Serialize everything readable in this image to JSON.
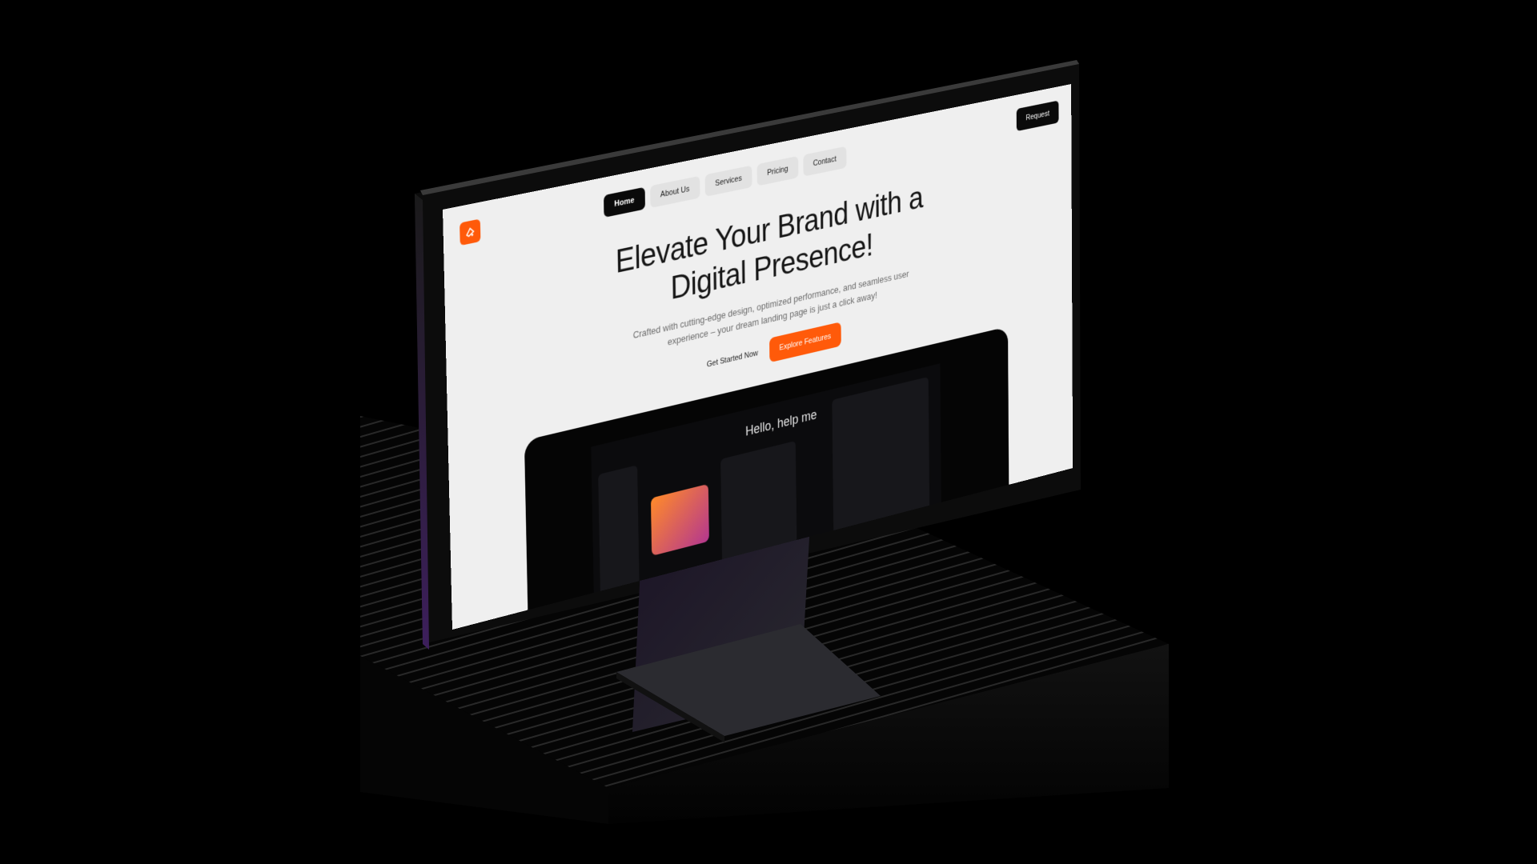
{
  "website": {
    "nav": {
      "items": [
        "Home",
        "About Us",
        "Services",
        "Pricing",
        "Contact"
      ],
      "active": "Home"
    },
    "request_label": "Request",
    "hero": {
      "title_line1": "Elevate Your Brand with a",
      "title_line2": "Digital Presence!",
      "subtitle_line1": "Crafted with cutting-edge design, optimized performance, and seamless user",
      "subtitle_line2": "experience – your dream landing page is just a click away!"
    },
    "cta": {
      "secondary_label": "Get Started Now",
      "primary_label": "Explore Features"
    },
    "preview": {
      "hello_text": "Hello, help me"
    }
  },
  "colors": {
    "accent": "#ff5a0a",
    "screen_bg": "#efefef",
    "scene_bg": "#000000"
  }
}
